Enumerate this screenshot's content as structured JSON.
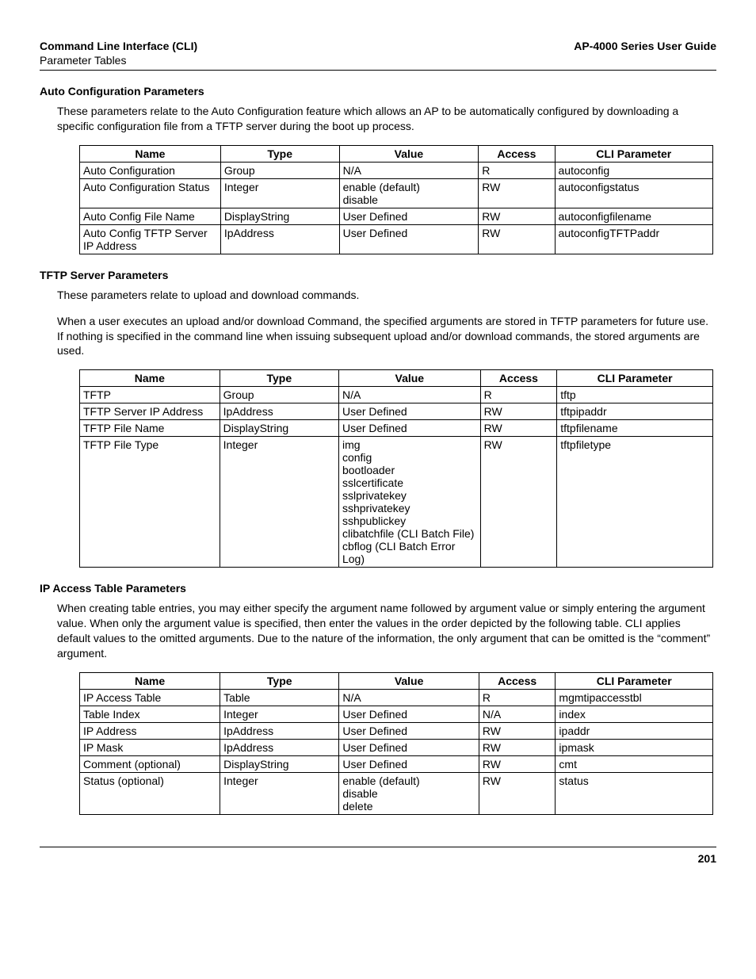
{
  "header": {
    "left_title": "Command Line Interface (CLI)",
    "left_sub": "Parameter Tables",
    "right_title": "AP-4000 Series User Guide"
  },
  "columns": {
    "name": "Name",
    "type": "Type",
    "value": "Value",
    "access": "Access",
    "cli": "CLI Parameter"
  },
  "sections": [
    {
      "title": "Auto Configuration Parameters",
      "paragraphs": [
        "These parameters relate to the Auto Configuration feature which allows an AP to be automatically configured by downloading a specific configuration file from a TFTP server during the boot up process."
      ],
      "rows": [
        {
          "name": "Auto Configuration",
          "type": "Group",
          "value": "N/A",
          "access": "R",
          "cli": "autoconfig"
        },
        {
          "name": "Auto Configuration Status",
          "type": "Integer",
          "value": "enable (default)\ndisable",
          "access": "RW",
          "cli": "autoconfigstatus"
        },
        {
          "name": "Auto Config File Name",
          "type": "DisplayString",
          "value": "User Defined",
          "access": "RW",
          "cli": "autoconfigfilename"
        },
        {
          "name": "Auto Config TFTP Server IP Address",
          "type": "IpAddress",
          "value": "User Defined",
          "access": "RW",
          "cli": "autoconfigTFTPaddr"
        }
      ]
    },
    {
      "title": "TFTP Server Parameters",
      "paragraphs": [
        "These parameters relate to upload and download commands.",
        "When a user executes an upload and/or download Command, the specified arguments are stored in TFTP parameters for future use. If nothing is specified in the command line when issuing subsequent upload and/or download commands, the stored arguments are used."
      ],
      "rows": [
        {
          "name": "TFTP",
          "type": "Group",
          "value": "N/A",
          "access": "R",
          "cli": "tftp"
        },
        {
          "name": "TFTP Server IP Address",
          "type": "IpAddress",
          "value": "User Defined",
          "access": "RW",
          "cli": "tftpipaddr"
        },
        {
          "name": "TFTP File Name",
          "type": "DisplayString",
          "value": "User Defined",
          "access": "RW",
          "cli": "tftpfilename"
        },
        {
          "name": "TFTP File Type",
          "type": "Integer",
          "value": "img\nconfig\nbootloader\nsslcertificate\nsslprivatekey\nsshprivatekey\nsshpublickey\nclibatchfile (CLI Batch File)\ncbflog (CLI Batch Error Log)",
          "access": "RW",
          "cli": "tftpfiletype"
        }
      ]
    },
    {
      "title": "IP Access Table Parameters",
      "paragraphs": [
        "When creating table entries, you may either specify the argument name followed by argument value or simply entering the argument value. When only the argument value is specified, then enter the values in the order depicted by the following table. CLI applies default values to the omitted arguments. Due to the nature of the information, the only argument that can be omitted is the “comment” argument."
      ],
      "rows": [
        {
          "name": "IP Access Table",
          "type": "Table",
          "value": "N/A",
          "access": "R",
          "cli": "mgmtipaccesstbl"
        },
        {
          "name": "Table Index",
          "type": "Integer",
          "value": "User Defined",
          "access": "N/A",
          "cli": "index"
        },
        {
          "name": "IP Address",
          "type": "IpAddress",
          "value": "User Defined",
          "access": "RW",
          "cli": "ipaddr"
        },
        {
          "name": "IP Mask",
          "type": "IpAddress",
          "value": "User Defined",
          "access": "RW",
          "cli": "ipmask"
        },
        {
          "name": "Comment (optional)",
          "type": "DisplayString",
          "value": "User Defined",
          "access": "RW",
          "cli": "cmt"
        },
        {
          "name": "Status (optional)",
          "type": "Integer",
          "value": "enable (default)\ndisable\ndelete",
          "access": "RW",
          "cli": "status"
        }
      ]
    }
  ],
  "page_number": "201"
}
